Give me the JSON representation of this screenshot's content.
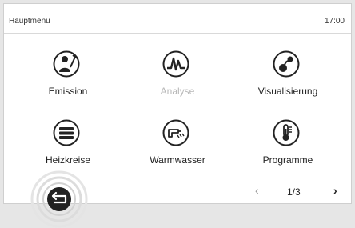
{
  "header": {
    "title": "Hauptmenü",
    "time": "17:00"
  },
  "menu": [
    {
      "label": "Emission",
      "icon": "chimney-sweep-icon",
      "enabled": true
    },
    {
      "label": "Analyse",
      "icon": "waveform-icon",
      "enabled": false
    },
    {
      "label": "Visualisierung",
      "icon": "flow-diagram-icon",
      "enabled": true
    },
    {
      "label": "Heizkreise",
      "icon": "radiator-icon",
      "enabled": true
    },
    {
      "label": "Warmwasser",
      "icon": "shower-tap-icon",
      "enabled": true
    },
    {
      "label": "Programme",
      "icon": "thermometer-icon",
      "enabled": true
    }
  ],
  "pager": {
    "prev_symbol": "‹",
    "page": "1/3",
    "next_symbol": "›"
  },
  "colors": {
    "accent": "#222222",
    "disabled": "#b8b8b8",
    "ripple": "#dedede"
  }
}
